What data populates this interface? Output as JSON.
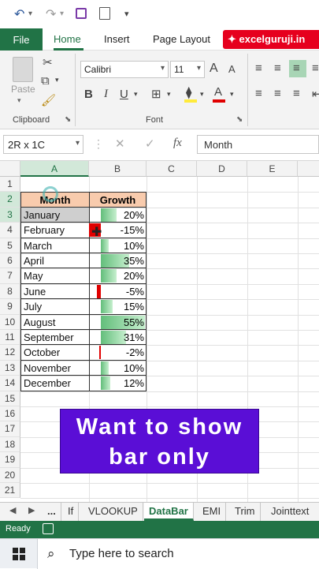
{
  "qat": {
    "undo_icon": "↶",
    "redo_icon": "↷",
    "save_icon": "💾",
    "preview_icon": "🔍",
    "more_icon": "▾"
  },
  "tabs": {
    "file": "File",
    "home": "Home",
    "insert": "Insert",
    "page_layout": "Page Layout",
    "brand": "✦ excelguruji.in"
  },
  "ribbon": {
    "clipboard_label": "Clipboard",
    "paste_label": "Paste",
    "font_name": "Calibri",
    "font_size": "11",
    "font_label": "Font",
    "bold": "B",
    "italic": "I",
    "underline": "U",
    "grow_font": "A",
    "shrink_font": "A"
  },
  "formula_bar": {
    "name_box": "2R x 1C",
    "formula": "Month",
    "fx": "fx"
  },
  "columns": [
    "A",
    "B",
    "C",
    "D",
    "E"
  ],
  "rows": [
    "1",
    "2",
    "3",
    "4",
    "5",
    "6",
    "7",
    "8",
    "9",
    "10",
    "11",
    "12",
    "13",
    "14",
    "15",
    "16",
    "17",
    "18",
    "19",
    "20",
    "21"
  ],
  "table": {
    "header_month": "Month",
    "header_growth": "Growth",
    "months": [
      "January",
      "February",
      "March",
      "April",
      "May",
      "June",
      "July",
      "August",
      "September",
      "October",
      "November",
      "December"
    ],
    "growth_labels": [
      "20%",
      "-15%",
      "10%",
      "35%",
      "20%",
      "-5%",
      "15%",
      "55%",
      "31%",
      "-2%",
      "10%",
      "12%"
    ],
    "growth_values": [
      20,
      -15,
      10,
      35,
      20,
      -5,
      15,
      55,
      31,
      -2,
      10,
      12
    ]
  },
  "banner": {
    "line1": "Want to show",
    "line2": "bar only"
  },
  "sheet_tabs": [
    "...",
    "If",
    "VLOOKUP",
    "DataBar",
    "EMI",
    "Trim",
    "Jointtext"
  ],
  "status": {
    "ready": "Ready"
  },
  "taskbar": {
    "search_placeholder": "Type here to search"
  },
  "colors": {
    "excel_green": "#217346",
    "header_fill": "#f8cbad",
    "bar_positive": "#63be7b",
    "bar_negative": "#e00000",
    "banner": "#5a0ed6"
  }
}
